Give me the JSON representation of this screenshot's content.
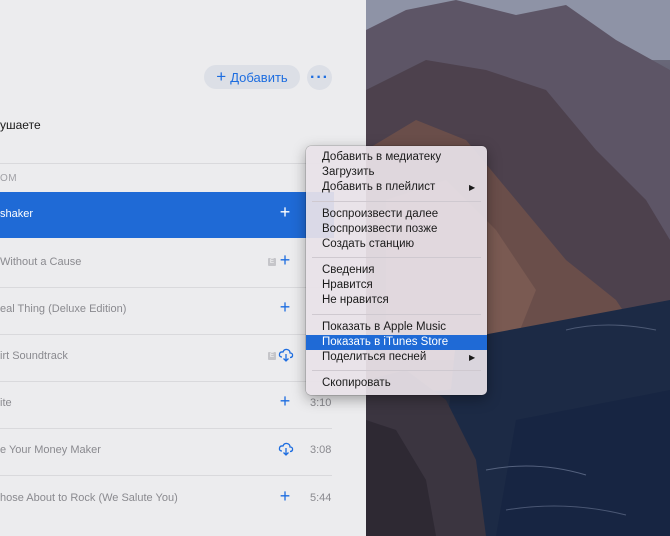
{
  "toolbar": {
    "add_label": "Добавить",
    "add_icon": "plus-icon",
    "more_icon": "ellipsis-icon"
  },
  "header": {
    "listening_text": "ушаете",
    "section_label": "ОМ"
  },
  "tracks": [
    {
      "title": "shaker",
      "selected": true,
      "action": "plus",
      "explicit": false,
      "duration": ""
    },
    {
      "title": "Without a Cause",
      "selected": false,
      "action": "plus",
      "explicit": true,
      "duration": ""
    },
    {
      "title": "eal Thing (Deluxe Edition)",
      "selected": false,
      "action": "plus",
      "explicit": false,
      "duration": ""
    },
    {
      "title": "irt Soundtrack",
      "selected": false,
      "action": "cloud",
      "explicit": true,
      "duration": ""
    },
    {
      "title": "ite",
      "selected": false,
      "action": "plus",
      "explicit": false,
      "duration": "3:10"
    },
    {
      "title": "e Your Money Maker",
      "selected": false,
      "action": "cloud",
      "explicit": false,
      "duration": "3:08"
    },
    {
      "title": "hose About to Rock (We Salute You)",
      "selected": false,
      "action": "plus",
      "explicit": false,
      "duration": "5:44"
    }
  ],
  "context_menu": {
    "items": [
      {
        "label": "Добавить в медиатеку",
        "submenu": false,
        "highlighted": false
      },
      {
        "label": "Загрузить",
        "submenu": false,
        "highlighted": false
      },
      {
        "label": "Добавить в плейлист",
        "submenu": true,
        "highlighted": false
      },
      {
        "label": "Воспроизвести далее",
        "submenu": false,
        "highlighted": false
      },
      {
        "label": "Воспроизвести позже",
        "submenu": false,
        "highlighted": false
      },
      {
        "label": "Создать станцию",
        "submenu": false,
        "highlighted": false
      },
      {
        "label": "Сведения",
        "submenu": false,
        "highlighted": false
      },
      {
        "label": "Нравится",
        "submenu": false,
        "highlighted": false
      },
      {
        "label": "Не нравится",
        "submenu": false,
        "highlighted": false
      },
      {
        "label": "Показать в Apple Music",
        "submenu": false,
        "highlighted": false
      },
      {
        "label": "Показать в iTunes Store",
        "submenu": false,
        "highlighted": true
      },
      {
        "label": "Поделиться песней",
        "submenu": true,
        "highlighted": false
      },
      {
        "label": "Скопировать",
        "submenu": false,
        "highlighted": false
      }
    ],
    "submenu_arrow": "▶"
  },
  "colors": {
    "accent": "#1f6ad6",
    "link": "#1d6de0",
    "panel": "#ececee"
  }
}
